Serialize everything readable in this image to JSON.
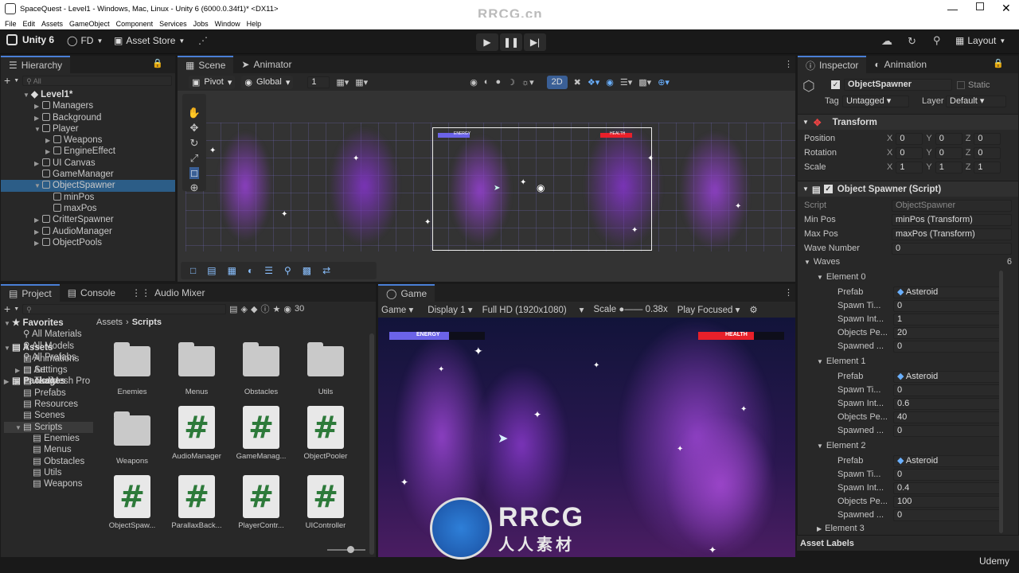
{
  "window": {
    "title": "SpaceQuest - Level1 - Windows, Mac, Linux - Unity 6 (6000.0.34f1)* <DX11>",
    "watermark": "RRCG.cn"
  },
  "menu": [
    "File",
    "Edit",
    "Assets",
    "GameObject",
    "Component",
    "Services",
    "Jobs",
    "Window",
    "Help"
  ],
  "toolbar": {
    "brand": "Unity 6",
    "account": "FD",
    "asset_store": "Asset Store",
    "layout": "Layout"
  },
  "hierarchy": {
    "tab": "Hierarchy",
    "search_placeholder": "All",
    "scene": "Level1*",
    "items": [
      {
        "label": "Managers",
        "depth": 1,
        "arrow": "right"
      },
      {
        "label": "Background",
        "depth": 1,
        "arrow": "right"
      },
      {
        "label": "Player",
        "depth": 1,
        "arrow": "down"
      },
      {
        "label": "Weapons",
        "depth": 2,
        "arrow": "right"
      },
      {
        "label": "EngineEffect",
        "depth": 2,
        "arrow": "right"
      },
      {
        "label": "UI Canvas",
        "depth": 1,
        "arrow": "right"
      },
      {
        "label": "GameManager",
        "depth": 1,
        "arrow": ""
      },
      {
        "label": "ObjectSpawner",
        "depth": 1,
        "arrow": "down",
        "selected": true
      },
      {
        "label": "minPos",
        "depth": 2,
        "arrow": ""
      },
      {
        "label": "maxPos",
        "depth": 2,
        "arrow": ""
      },
      {
        "label": "CritterSpawner",
        "depth": 1,
        "arrow": "right"
      },
      {
        "label": "AudioManager",
        "depth": 1,
        "arrow": "right"
      },
      {
        "label": "ObjectPools",
        "depth": 1,
        "arrow": "right"
      }
    ]
  },
  "scene": {
    "tabs": [
      "Scene",
      "Animator"
    ],
    "pivot": "Pivot",
    "global": "Global",
    "grid_value": "1",
    "mode_2d": "2D",
    "hud_energy": "ENERGY",
    "hud_health": "HEALTH"
  },
  "project": {
    "tabs": [
      "Project",
      "Console",
      "Audio Mixer"
    ],
    "count": "30",
    "favorites": "Favorites",
    "fav_items": [
      "All Materials",
      "All Models",
      "All Prefabs"
    ],
    "assets": "Assets",
    "asset_folders": [
      "Animations",
      "Art",
      "Audio",
      "Prefabs",
      "Resources",
      "Scenes",
      "Scripts"
    ],
    "scripts_children": [
      "Enemies",
      "Menus",
      "Obstacles",
      "Utils",
      "Weapons"
    ],
    "more_folders": [
      "Settings",
      "TextMesh Pro"
    ],
    "packages": "Packages",
    "breadcrumb_root": "Assets",
    "breadcrumb_leaf": "Scripts",
    "grid_items": [
      {
        "label": "Enemies",
        "kind": "folder"
      },
      {
        "label": "Menus",
        "kind": "folder"
      },
      {
        "label": "Obstacles",
        "kind": "folder"
      },
      {
        "label": "Utils",
        "kind": "folder"
      },
      {
        "label": "Weapons",
        "kind": "folder"
      },
      {
        "label": "AudioManager",
        "kind": "script"
      },
      {
        "label": "GameManag...",
        "kind": "script"
      },
      {
        "label": "ObjectPooler",
        "kind": "script"
      },
      {
        "label": "ObjectSpaw...",
        "kind": "script"
      },
      {
        "label": "ParallaxBack...",
        "kind": "script"
      },
      {
        "label": "PlayerContr...",
        "kind": "script"
      },
      {
        "label": "UIController",
        "kind": "script"
      }
    ]
  },
  "game": {
    "tab": "Game",
    "view": "Game",
    "display": "Display 1",
    "resolution": "Full HD (1920x1080)",
    "scale_label": "Scale",
    "scale_value": "0.38x",
    "play_mode": "Play Focused",
    "energy": "ENERGY",
    "health": "HEALTH"
  },
  "inspector": {
    "tabs": [
      "Inspector",
      "Animation"
    ],
    "object_name": "ObjectSpawner",
    "static": "Static",
    "tag_label": "Tag",
    "tag_value": "Untagged",
    "layer_label": "Layer",
    "layer_value": "Default",
    "transform": {
      "title": "Transform",
      "rows": [
        {
          "label": "Position",
          "x": "0",
          "y": "0",
          "z": "0"
        },
        {
          "label": "Rotation",
          "x": "0",
          "y": "0",
          "z": "0"
        },
        {
          "label": "Scale",
          "x": "1",
          "y": "1",
          "z": "1"
        }
      ]
    },
    "script_component": {
      "title": "Object Spawner (Script)",
      "script_label": "Script",
      "script_value": "ObjectSpawner",
      "min_label": "Min Pos",
      "min_value": "minPos (Transform)",
      "max_label": "Max Pos",
      "max_value": "maxPos (Transform)",
      "wave_label": "Wave Number",
      "wave_value": "0",
      "waves_label": "Waves",
      "waves_count": "6"
    },
    "elements": [
      {
        "title": "Element 0",
        "prefab": "Asteroid",
        "spawn_time": "0",
        "spawn_interval": "1",
        "objects_per": "20",
        "spawned": "0"
      },
      {
        "title": "Element 1",
        "prefab": "Asteroid",
        "spawn_time": "0",
        "spawn_interval": "0.6",
        "objects_per": "40",
        "spawned": "0"
      },
      {
        "title": "Element 2",
        "prefab": "Asteroid",
        "spawn_time": "0",
        "spawn_interval": "0.4",
        "objects_per": "100",
        "spawned": "0"
      }
    ],
    "element3": "Element 3",
    "field_labels": {
      "prefab": "Prefab",
      "spawn_time": "Spawn Ti...",
      "spawn_interval": "Spawn Int...",
      "objects_per": "Objects Pe...",
      "spawned": "Spawned ..."
    },
    "asset_labels": "Asset Labels"
  },
  "overlay": {
    "logo_text": "RRCG",
    "logo_sub": "人人素材",
    "udemy": "Udemy"
  },
  "colors": {
    "accent": "#4a7fd6",
    "selection": "#2c5d87",
    "energy": "#6b63e8",
    "health": "#e8202a"
  }
}
